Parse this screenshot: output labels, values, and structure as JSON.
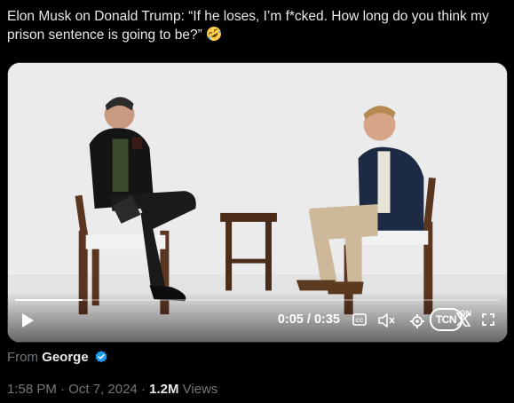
{
  "tweet": {
    "text": "Elon Musk on Donald Trump: “If he loses, I’m f*cked. How long do you think my prison sentence is going to be?”",
    "emoji": "rolling-on-floor-laughing-emoji"
  },
  "video": {
    "time_current": "0:05",
    "time_separator": "/",
    "time_total": "0:35",
    "progress": 0.14,
    "watermark": "TCN",
    "watermark_on": "ON"
  },
  "attribution": {
    "prefix": "From",
    "name": "George"
  },
  "meta": {
    "time": "1:58 PM",
    "separator1": "·",
    "date": "Oct 7, 2024",
    "separator2": "·",
    "views_count": "1.2M",
    "views_label": "Views"
  },
  "colors": {
    "background": "#000000",
    "text": "#e7e9ea",
    "muted": "#71767b",
    "verified": "#1d9bf0"
  }
}
